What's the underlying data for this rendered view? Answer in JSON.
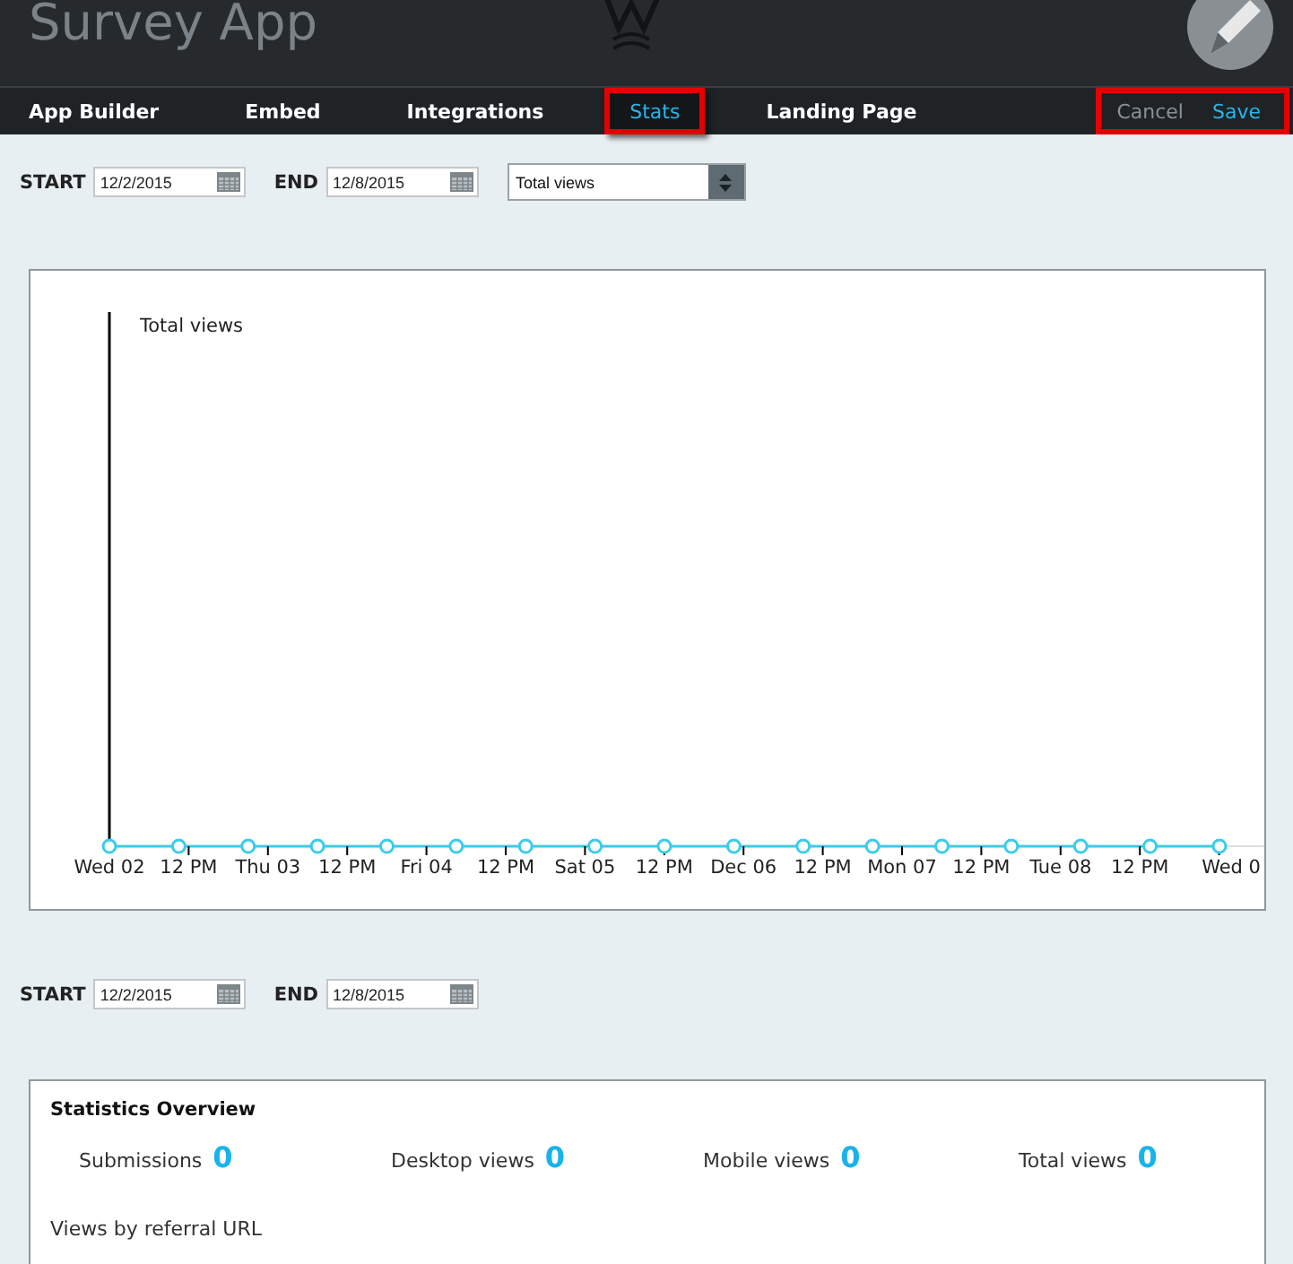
{
  "header": {
    "title": "Survey App"
  },
  "nav": {
    "tabs": [
      {
        "label": "App Builder",
        "selected": false,
        "highlighted": false
      },
      {
        "label": "Embed",
        "selected": false,
        "highlighted": false
      },
      {
        "label": "Integrations",
        "selected": false,
        "highlighted": false
      },
      {
        "label": "Stats",
        "selected": true,
        "highlighted": true
      },
      {
        "label": "Landing Page",
        "selected": false,
        "highlighted": false
      }
    ],
    "actions": {
      "highlighted": true,
      "buttons": [
        {
          "label": "Cancel",
          "kind": "secondary"
        },
        {
          "label": "Save",
          "kind": "primary"
        }
      ]
    }
  },
  "top_filter": {
    "start_label": "START",
    "start": "12/2/2015",
    "end_label": "END",
    "end": "12/8/2015",
    "metric": "Total views"
  },
  "chart": {
    "series_label": "Total views",
    "x_labels": [
      "Wed 02",
      "12 PM",
      "Thu 03",
      "12 PM",
      "Fri 04",
      "12 PM",
      "Sat 05",
      "12 PM",
      "Dec 06",
      "12 PM",
      "Mon 07",
      "12 PM",
      "Tue 08",
      "12 PM",
      "Wed 0"
    ]
  },
  "bottom_filter": {
    "start_label": "START",
    "start": "12/2/2015",
    "end_label": "END",
    "end": "12/8/2015"
  },
  "overview": {
    "title": "Statistics Overview",
    "stats": [
      {
        "label": "Submissions",
        "value": "0"
      },
      {
        "label": "Desktop views",
        "value": "0"
      },
      {
        "label": "Mobile views",
        "value": "0"
      },
      {
        "label": "Total views",
        "value": "0"
      }
    ],
    "referral_label": "Views by referral URL"
  }
}
